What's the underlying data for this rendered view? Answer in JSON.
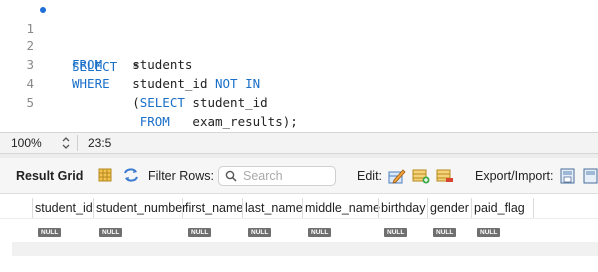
{
  "editor": {
    "lines": [
      {
        "num": "1",
        "tokens": [
          {
            "t": "SELECT",
            "kw": true
          },
          {
            "t": "  *",
            "kw": false
          }
        ],
        "breakpoint": true
      },
      {
        "num": "2",
        "tokens": [
          {
            "t": "FROM",
            "kw": true
          },
          {
            "t": "    students",
            "kw": false
          }
        ],
        "breakpoint": false
      },
      {
        "num": "3",
        "tokens": [
          {
            "t": "WHERE",
            "kw": true
          },
          {
            "t": "   student_id ",
            "kw": false
          },
          {
            "t": "NOT IN",
            "kw": true
          }
        ],
        "breakpoint": false
      },
      {
        "num": "4",
        "tokens": [
          {
            "t": "        (",
            "kw": false
          },
          {
            "t": "SELECT",
            "kw": true
          },
          {
            "t": " student_id",
            "kw": false
          }
        ],
        "breakpoint": false
      },
      {
        "num": "5",
        "tokens": [
          {
            "t": "         ",
            "kw": false
          },
          {
            "t": "FROM",
            "kw": true
          },
          {
            "t": "   exam_results);",
            "kw": false
          }
        ],
        "breakpoint": false
      }
    ]
  },
  "statusbar": {
    "zoom": "100%",
    "cursor_position": "23:5"
  },
  "result_toolbar": {
    "title": "Result Grid",
    "filter_label": "Filter Rows:",
    "search_placeholder": "Search",
    "edit_label": "Edit:",
    "export_label": "Export/Import:"
  },
  "grid": {
    "columns": [
      "student_id",
      "student_number",
      "first_name",
      "last_name",
      "middle_name",
      "birthday",
      "gender",
      "paid_flag"
    ],
    "null_label": "NULL"
  },
  "colors": {
    "keyword": "#1a6fc9",
    "breakpoint": "#1f6fd6",
    "null_badge": "#6f6f6f"
  }
}
